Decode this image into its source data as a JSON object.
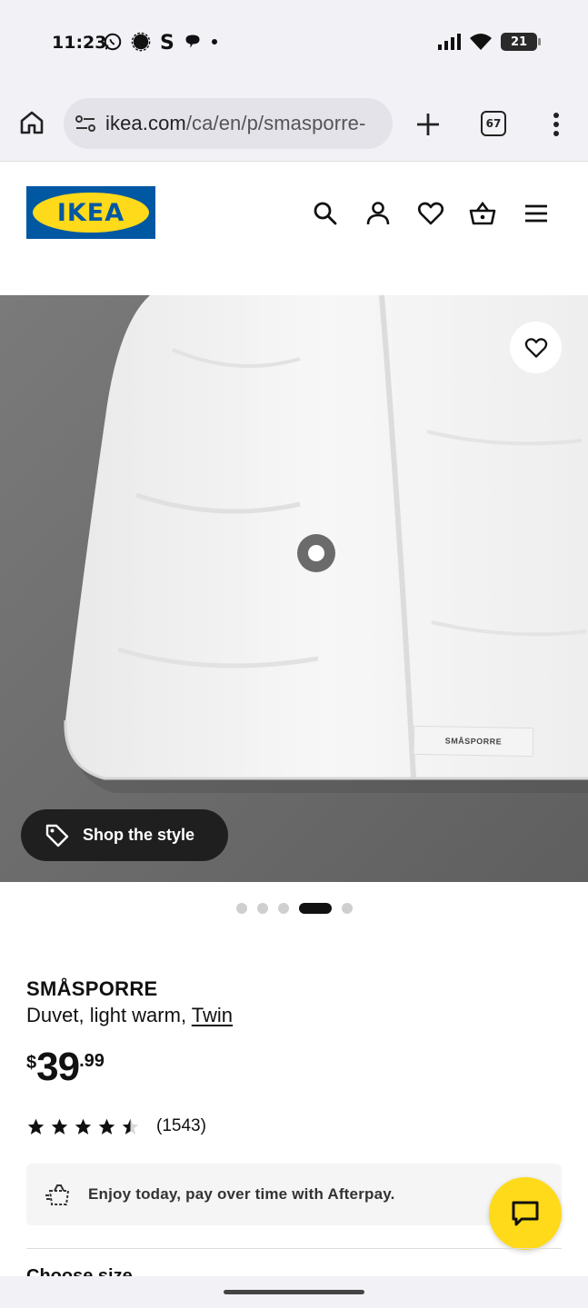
{
  "status_bar": {
    "time": "11:23",
    "battery": "21",
    "left_icons": [
      "whatsapp-icon",
      "signal-app-icon",
      "s-app-icon",
      "chat-bubble-icon",
      "dot-icon"
    ],
    "right_icons": [
      "cell-signal-icon",
      "wifi-icon",
      "battery-icon"
    ]
  },
  "browser": {
    "url_host": "ikea.com",
    "url_path": "/ca/en/p/smasporre-",
    "tab_count": "67"
  },
  "header": {
    "logo_text": "IKEA",
    "icons": [
      "search-icon",
      "account-icon",
      "favourites-icon",
      "cart-icon",
      "menu-icon"
    ]
  },
  "gallery": {
    "tag_text": "SMÅSPORRE",
    "shop_style_label": "Shop the style",
    "dots_total": 5,
    "active_dot": 4
  },
  "product": {
    "name": "SMÅSPORRE",
    "description": "Duvet, light warm, ",
    "size_link": "Twin",
    "price_symbol": "$",
    "price_integer": "39",
    "price_decimal": ".99",
    "rating": 4.5,
    "rating_count": "(1543)"
  },
  "afterpay": {
    "text": "Enjoy today, pay over time with Afterpay."
  },
  "section": {
    "choose_size": "Choose size"
  },
  "colors": {
    "ikea_blue": "#0058a3",
    "ikea_yellow": "#ffda1a"
  }
}
